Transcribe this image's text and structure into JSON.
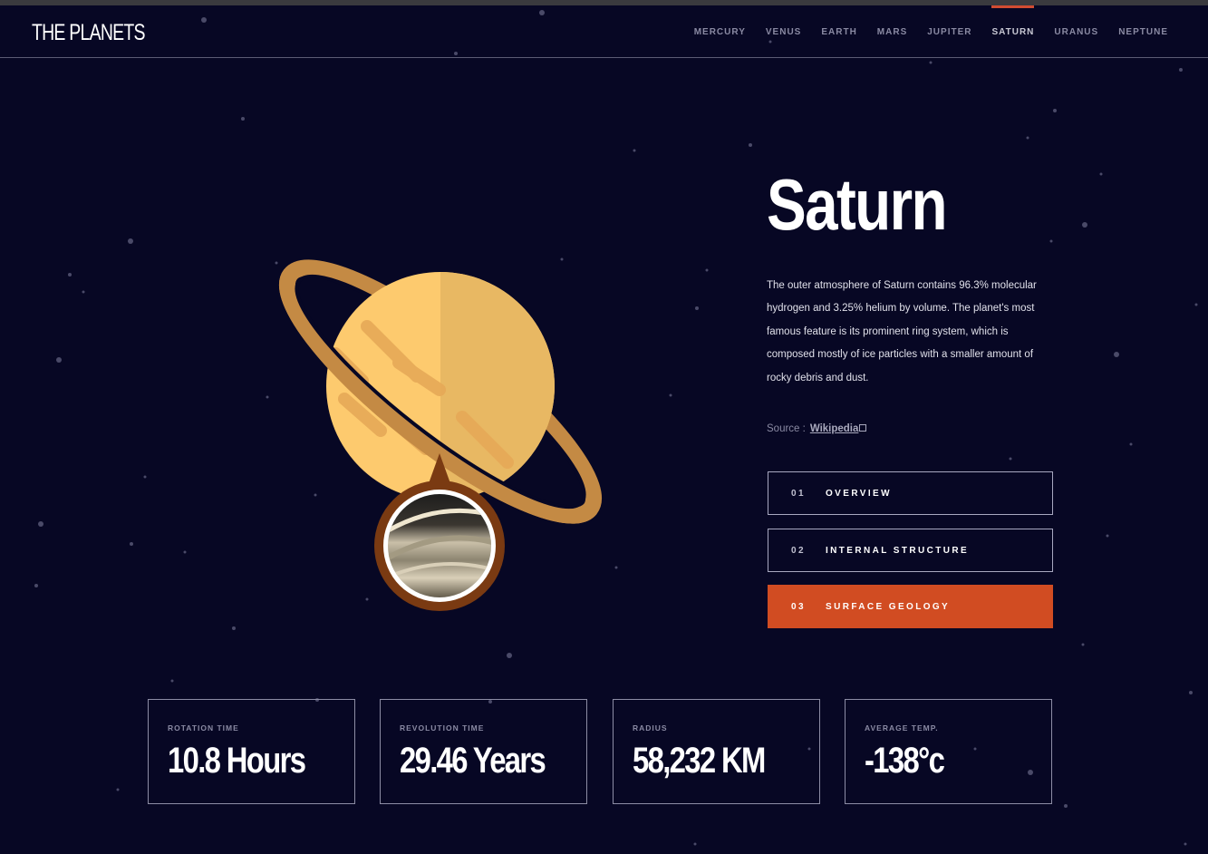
{
  "header": {
    "logo": "THE PLANETS",
    "nav": [
      {
        "label": "MERCURY",
        "active": false
      },
      {
        "label": "VENUS",
        "active": false
      },
      {
        "label": "EARTH",
        "active": false
      },
      {
        "label": "MARS",
        "active": false
      },
      {
        "label": "JUPITER",
        "active": false
      },
      {
        "label": "SATURN",
        "active": true
      },
      {
        "label": "URANUS",
        "active": false
      },
      {
        "label": "NEPTUNE",
        "active": false
      }
    ]
  },
  "planet": {
    "name": "Saturn",
    "description": "The outer atmosphere of Saturn contains 96.3% molecular hydrogen and 3.25% helium by volume. The planet's most famous feature is its prominent ring system, which is composed mostly of ice particles with a smaller amount of rocky debris and dust.",
    "source_label": "Source :",
    "source_link": "Wikipedia",
    "accent_color": "#d14c22"
  },
  "tabs": [
    {
      "number": "01",
      "label": "OVERVIEW",
      "active": false
    },
    {
      "number": "02",
      "label": "INTERNAL STRUCTURE",
      "active": false
    },
    {
      "number": "03",
      "label": "SURFACE GEOLOGY",
      "active": true
    }
  ],
  "stats": [
    {
      "label": "ROTATION TIME",
      "value": "10.8 Hours"
    },
    {
      "label": "REVOLUTION TIME",
      "value": "29.46 Years"
    },
    {
      "label": "RADIUS",
      "value": "58,232 KM"
    },
    {
      "label": "AVERAGE TEMP.",
      "value": "-138°c"
    }
  ],
  "icons": {
    "external_link": "external-link-icon"
  }
}
